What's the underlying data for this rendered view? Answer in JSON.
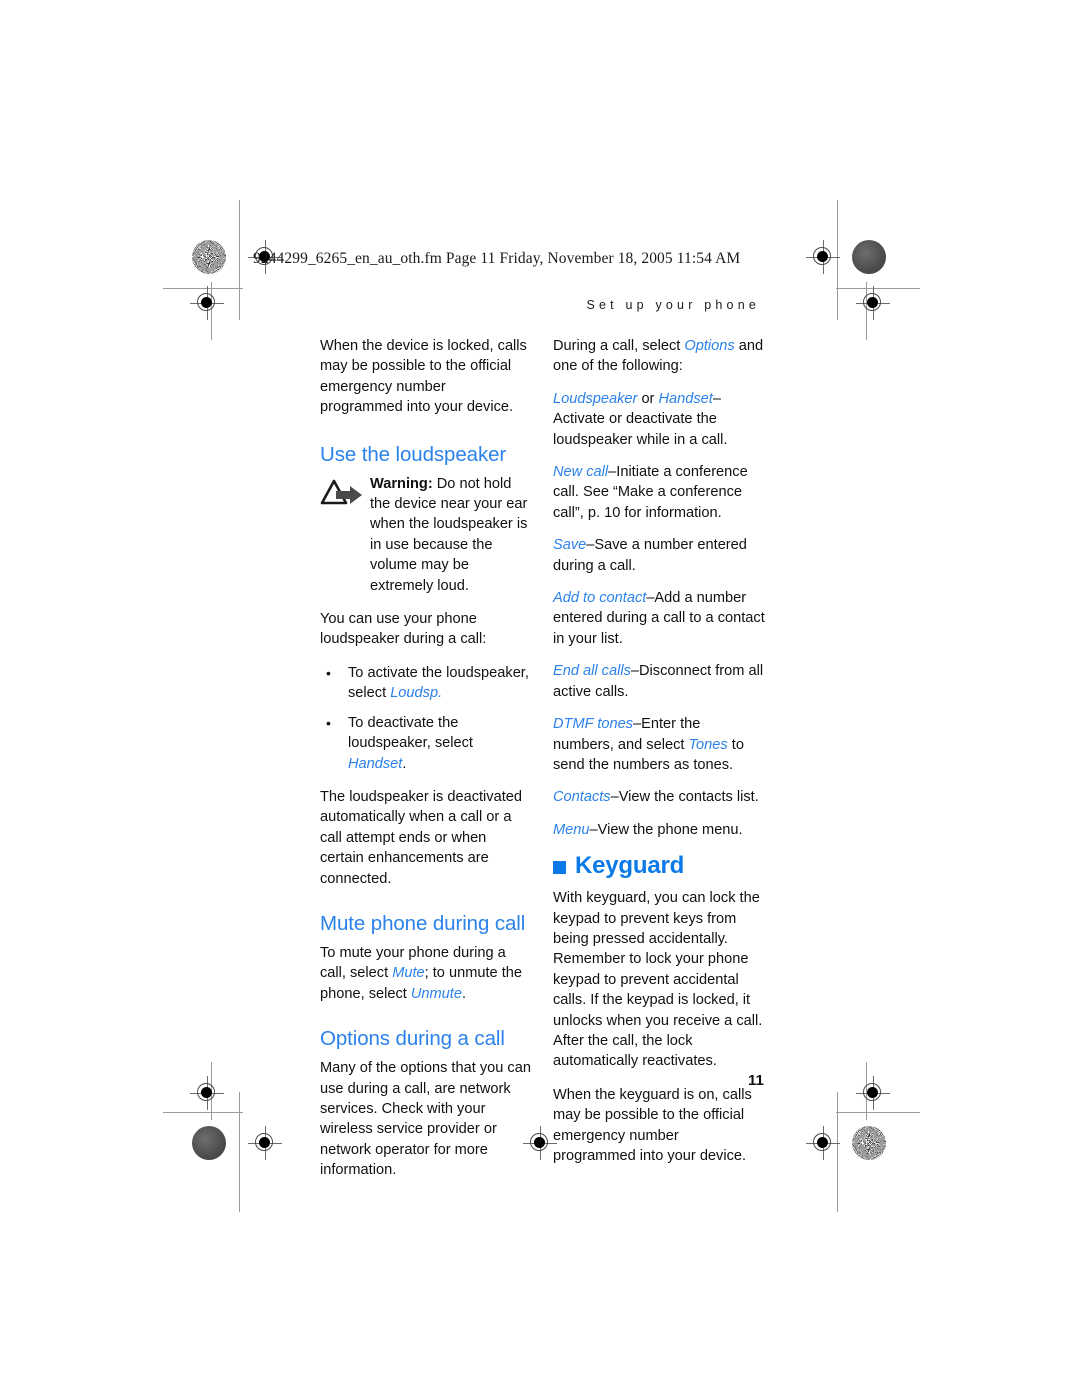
{
  "document": {
    "slug": "9244299_6265_en_au_oth.fm  Page 11  Friday, November 18, 2005  11:54 AM",
    "running_head": "Set up your phone",
    "page_number": "11",
    "accent_color": "#2b82ea",
    "heading_color": "#0b7ae8",
    "text_color": "#111111"
  },
  "left_column": {
    "intro_paragraph": "When the device is locked, calls may be possible to the official emergency number programmed into your device.",
    "loudspeaker": {
      "heading": "Use the loudspeaker",
      "warning_icon": "warning-triangle-arrow-icon",
      "warning_label": "Warning:",
      "warning_text": " Do not hold the device near your ear when the loudspeaker is in use because the volume may be extremely loud.",
      "body": "You can use your phone loudspeaker during a call:",
      "bullets": [
        {
          "marker": "•",
          "text_before": "To activate the loudspeaker, select ",
          "term": "Loudsp.",
          "text_after": ""
        },
        {
          "marker": "•",
          "text_before": "To deactivate the loudspeaker, select ",
          "term": "Handset",
          "text_after": "."
        }
      ],
      "closing": "The loudspeaker is deactivated automatically when a call or a call attempt ends or when certain enhancements are connected."
    },
    "mute": {
      "heading": "Mute phone during call",
      "text_1": "To mute your phone during a call, select ",
      "term_1": "Mute",
      "text_2": "; to unmute the phone, select ",
      "term_2": "Unmute",
      "text_3": "."
    },
    "options": {
      "heading": "Options during a call",
      "body": "Many of the options that you can use during a call, are network services. Check with your wireless service provider or network operator for more information."
    }
  },
  "right_column": {
    "intro": {
      "text_before": "During a call, select ",
      "term": "Options",
      "text_after": " and one of the following:"
    },
    "options_list": [
      {
        "term": "Loudspeaker",
        "joiner": " or ",
        "term2": "Handset",
        "description": "–Activate or deactivate the loudspeaker while in a call."
      },
      {
        "term": "New call",
        "description": "–Initiate a conference call. See “Make a conference call”, p. 10 for information."
      },
      {
        "term": "Save",
        "description": "–Save a number entered during a call."
      },
      {
        "term": "Add to contact",
        "description": "–Add a number entered during a call to a contact in your list."
      },
      {
        "term": "End all calls",
        "description": "–Disconnect from all active calls."
      },
      {
        "term": "DTMF tones",
        "description": "–Enter the numbers, and select ",
        "inline_term": "Tones",
        "description_after": " to send the numbers as tones."
      },
      {
        "term": "Contacts",
        "description": "–View the contacts list."
      },
      {
        "term": "Menu",
        "description": "–View the phone menu."
      }
    ],
    "keyguard": {
      "heading": "Keyguard",
      "bullet_icon": "blue-square-bullet",
      "paragraph_1": "With keyguard, you can lock the keypad to prevent keys from being pressed accidentally. Remember to lock your phone keypad to prevent accidental calls. If the keypad is locked, it unlocks when you receive a call. After the call, the lock automatically reactivates.",
      "paragraph_2": "When the keyguard is on, calls may be possible to the official emergency number programmed into your device."
    }
  }
}
